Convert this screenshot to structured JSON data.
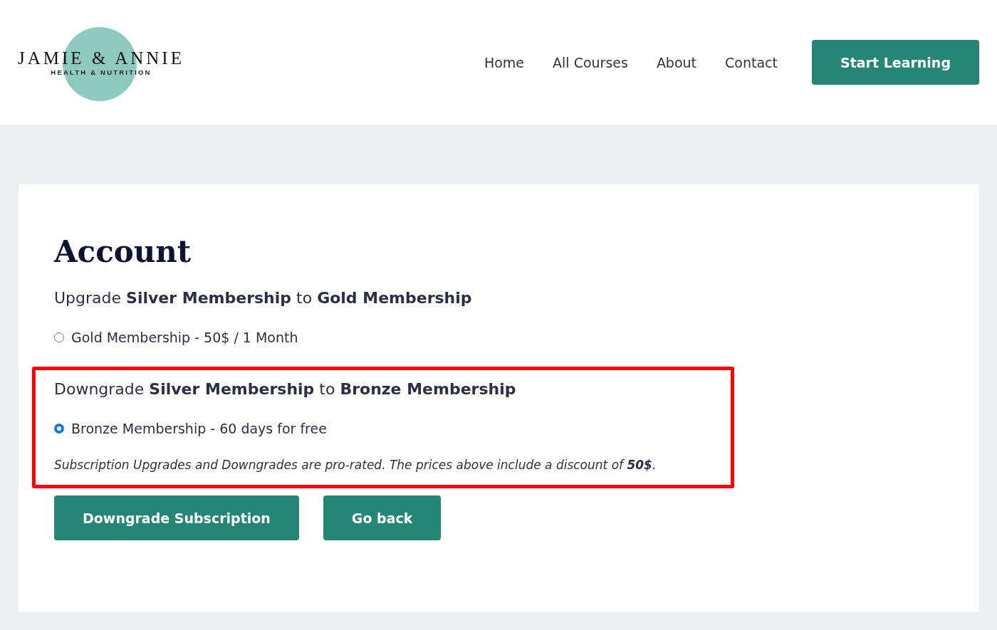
{
  "header": {
    "logo": {
      "name": "JAMIE & ANNIE",
      "tagline": "HEALTH & NUTRITION"
    },
    "nav": [
      {
        "label": "Home"
      },
      {
        "label": "All Courses"
      },
      {
        "label": "About"
      },
      {
        "label": "Contact"
      }
    ],
    "cta": "Start Learning"
  },
  "account": {
    "title": "Account",
    "sections": [
      {
        "heading": "Upgrade **Silver Membership** to **Gold Membership**",
        "options": [
          {
            "label": "Gold Membership - 50$ / 1 Month",
            "selected": false
          }
        ]
      },
      {
        "heading": "Downgrade **Silver Membership** to **Bronze Membership**",
        "highlighted": true,
        "options": [
          {
            "label": "Bronze Membership - 60 days for free",
            "selected": true
          }
        ],
        "note": "Subscription Upgrades and Downgrades are pro-rated. The prices above include a discount of **50$**."
      }
    ],
    "buttons": [
      {
        "label": "Downgrade Subscription"
      },
      {
        "label": "Go back"
      }
    ]
  }
}
